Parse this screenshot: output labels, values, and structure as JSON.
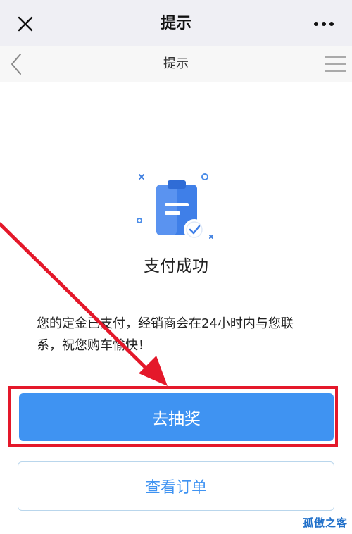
{
  "header": {
    "title": "提示",
    "close_icon": "close-icon",
    "more_icon": "more-dots-icon"
  },
  "nav": {
    "title": "提示",
    "back_icon": "chevron-left-icon",
    "menu_icon": "menu-icon"
  },
  "result": {
    "illustration_icon": "clipboard-check-icon",
    "title": "支付成功",
    "message": "您的定金已支付，经销商会在24小时内与您联系，祝您购车愉快！"
  },
  "actions": {
    "primary_label": "去抽奖",
    "secondary_label": "查看订单"
  },
  "watermark": "孤傲之客",
  "colors": {
    "primary": "#3f93f2",
    "highlight": "#e4182a",
    "topbar_bg": "#efeff4"
  }
}
